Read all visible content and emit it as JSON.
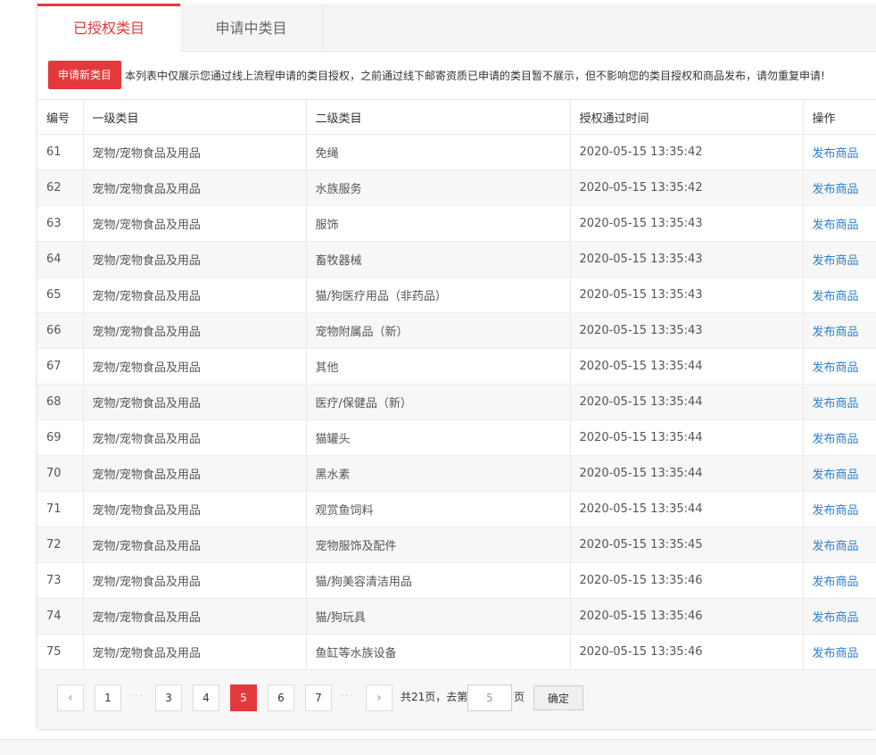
{
  "tabs": [
    {
      "label": "已授权类目"
    },
    {
      "label": "申请中类目"
    }
  ],
  "notice": {
    "button": "申请新类目",
    "text": "本列表中仅展示您通过线上流程申请的类目授权，之前通过线下邮寄资质已申请的类目暂不展示，但不影响您的类目授权和商品发布，请勿重复申请!"
  },
  "table": {
    "headers": [
      "编号",
      "一级类目",
      "二级类目",
      "授权通过时间",
      "操作"
    ],
    "rows": [
      [
        "61",
        "宠物/宠物食品及用品",
        "免绳",
        "2020-05-15 13:35:42",
        "发布商品"
      ],
      [
        "62",
        "宠物/宠物食品及用品",
        "水族服务",
        "2020-05-15 13:35:42",
        "发布商品"
      ],
      [
        "63",
        "宠物/宠物食品及用品",
        "服饰",
        "2020-05-15 13:35:43",
        "发布商品"
      ],
      [
        "64",
        "宠物/宠物食品及用品",
        "畜牧器械",
        "2020-05-15 13:35:43",
        "发布商品"
      ],
      [
        "65",
        "宠物/宠物食品及用品",
        "猫/狗医疗用品（非药品）",
        "2020-05-15 13:35:43",
        "发布商品"
      ],
      [
        "66",
        "宠物/宠物食品及用品",
        "宠物附属品（新）",
        "2020-05-15 13:35:43",
        "发布商品"
      ],
      [
        "67",
        "宠物/宠物食品及用品",
        "其他",
        "2020-05-15 13:35:44",
        "发布商品"
      ],
      [
        "68",
        "宠物/宠物食品及用品",
        "医疗/保健品（新）",
        "2020-05-15 13:35:44",
        "发布商品"
      ],
      [
        "69",
        "宠物/宠物食品及用品",
        "猫罐头",
        "2020-05-15 13:35:44",
        "发布商品"
      ],
      [
        "70",
        "宠物/宠物食品及用品",
        "黑水素",
        "2020-05-15 13:35:44",
        "发布商品"
      ],
      [
        "71",
        "宠物/宠物食品及用品",
        "观赏鱼饲料",
        "2020-05-15 13:35:44",
        "发布商品"
      ],
      [
        "72",
        "宠物/宠物食品及用品",
        "宠物服饰及配件",
        "2020-05-15 13:35:45",
        "发布商品"
      ],
      [
        "73",
        "宠物/宠物食品及用品",
        "猫/狗美容清洁用品",
        "2020-05-15 13:35:46",
        "发布商品"
      ],
      [
        "74",
        "宠物/宠物食品及用品",
        "猫/狗玩具",
        "2020-05-15 13:35:46",
        "发布商品"
      ],
      [
        "75",
        "宠物/宠物食品及用品",
        "鱼缸等水族设备",
        "2020-05-15 13:35:46",
        "发布商品"
      ]
    ]
  },
  "pagination": {
    "prev": "‹",
    "next": "›",
    "pages": [
      "1",
      "3",
      "4",
      "5",
      "6",
      "7"
    ],
    "current": "5",
    "ellipsis": "···",
    "total_text": "共21页，去第",
    "goto_value": "5",
    "unit": "页",
    "confirm": "确定"
  },
  "colors": {
    "accent": "#e4393c",
    "link": "#2a7fcf"
  }
}
